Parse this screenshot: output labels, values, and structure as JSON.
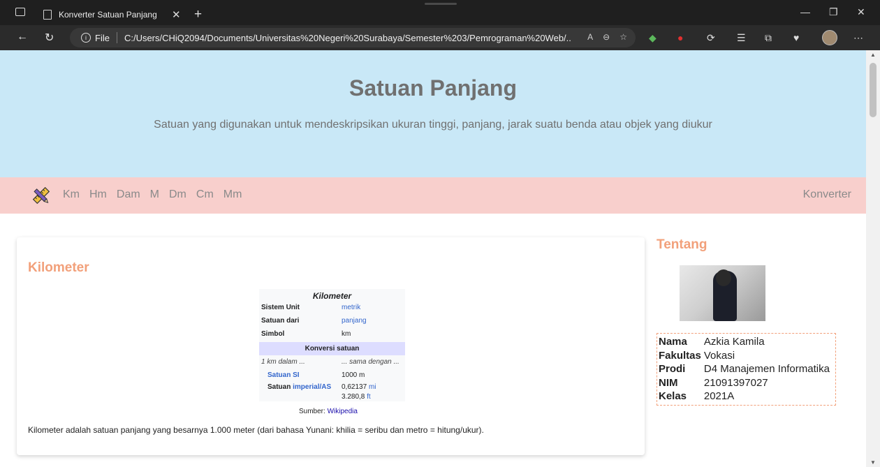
{
  "browser": {
    "tab_title": "Konverter Satuan Panjang",
    "url_scheme": "File",
    "url": "C:/Users/CHiQ2094/Documents/Universitas%20Negeri%20Surabaya/Semester%203/Pemrograman%20Web/..."
  },
  "hero": {
    "title": "Satuan Panjang",
    "subtitle": "Satuan yang digunakan untuk mendeskripsikan ukuran tinggi, panjang, jarak suatu benda atau objek yang diukur"
  },
  "nav": {
    "links": [
      "Km",
      "Hm",
      "Dam",
      "M",
      "Dm",
      "Cm",
      "Mm"
    ],
    "right": "Konverter"
  },
  "main": {
    "heading": "Kilometer",
    "infobox": {
      "title": "Kilometer",
      "rows": [
        {
          "key": "Sistem Unit",
          "value": "metrik"
        },
        {
          "key": "Satuan dari",
          "value": "panjang"
        },
        {
          "key": "Simbol",
          "value": "km"
        }
      ],
      "section": "Konversi satuan",
      "italic_left": "1 km dalam ...",
      "italic_right": "... sama dengan ...",
      "si_key": "Satuan SI",
      "si_value": "1000 m",
      "imp_key_prefix": "Satuan ",
      "imp_key_link": "imperial/AS",
      "imp_value_1_num": "0,62137",
      "imp_value_1_unit": "mi",
      "imp_value_2_num": "3.280,8",
      "imp_value_2_unit": "ft"
    },
    "source_label": "Sumber:",
    "source_link": "Wikipedia",
    "description": "Kilometer adalah satuan panjang yang besarnya 1.000 meter (dari bahasa Yunani: khilia = seribu dan metro = hitung/ukur)."
  },
  "aside": {
    "title": "Tentang",
    "profile": [
      {
        "key": "Nama",
        "value": "Azkia Kamila"
      },
      {
        "key": "Fakultas",
        "value": "Vokasi"
      },
      {
        "key": "Prodi",
        "value": "D4 Manajemen Informatika"
      },
      {
        "key": "NIM",
        "value": "21091397027"
      },
      {
        "key": "Kelas",
        "value": "2021A"
      }
    ]
  },
  "colors": {
    "hero_bg": "#c9e8f7",
    "nav_bg": "#f8cfcc",
    "accent": "#f2a07a"
  }
}
